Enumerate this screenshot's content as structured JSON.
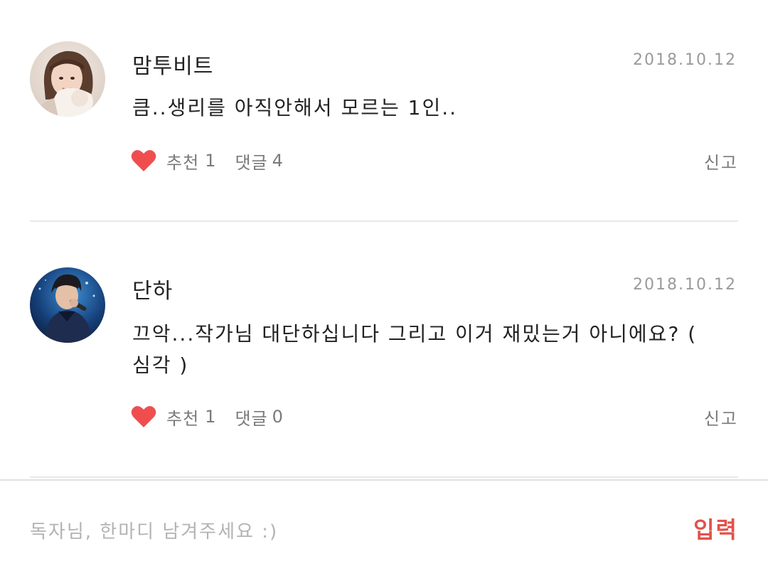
{
  "comments": [
    {
      "author": "맘투비트",
      "date": "2018.10.12",
      "text": "큼..생리를 아직안해서 모르는 1인..",
      "like_label": "추천",
      "like_count": "1",
      "reply_label": "댓글",
      "reply_count": "4",
      "report_label": "신고"
    },
    {
      "author": "단하",
      "date": "2018.10.12",
      "text": "끄악...작가님 대단하십니다  그리고 이거 재밌는거 아니에요? ( 심각 )",
      "like_label": "추천",
      "like_count": "1",
      "reply_label": "댓글",
      "reply_count": "0",
      "report_label": "신고"
    }
  ],
  "input_bar": {
    "placeholder": "독자님, 한마디 남겨주세요 :)",
    "submit_label": "입력"
  },
  "colors": {
    "heart": "#f04e4e",
    "submit": "#e4514a",
    "muted_text": "#7a7a7a",
    "date_text": "#9a9a9a",
    "divider": "#e8e8e8"
  }
}
